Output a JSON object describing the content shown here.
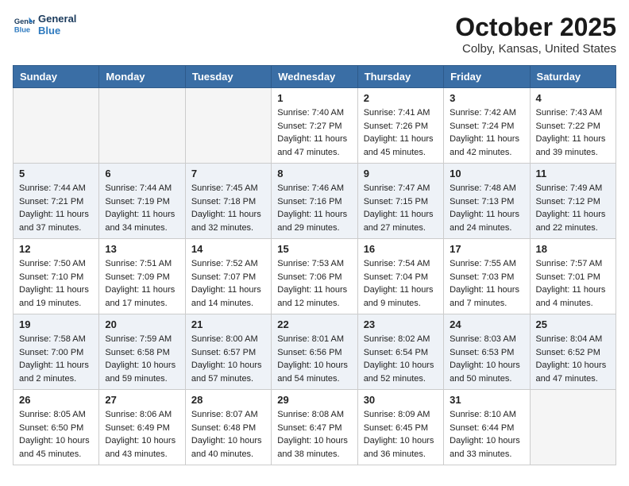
{
  "header": {
    "logo_line1": "General",
    "logo_line2": "Blue",
    "month_title": "October 2025",
    "location": "Colby, Kansas, United States"
  },
  "weekdays": [
    "Sunday",
    "Monday",
    "Tuesday",
    "Wednesday",
    "Thursday",
    "Friday",
    "Saturday"
  ],
  "weeks": [
    [
      {
        "day": "",
        "sunrise": "",
        "sunset": "",
        "daylight": "",
        "empty": true
      },
      {
        "day": "",
        "sunrise": "",
        "sunset": "",
        "daylight": "",
        "empty": true
      },
      {
        "day": "",
        "sunrise": "",
        "sunset": "",
        "daylight": "",
        "empty": true
      },
      {
        "day": "1",
        "sunrise": "Sunrise: 7:40 AM",
        "sunset": "Sunset: 7:27 PM",
        "daylight": "Daylight: 11 hours and 47 minutes."
      },
      {
        "day": "2",
        "sunrise": "Sunrise: 7:41 AM",
        "sunset": "Sunset: 7:26 PM",
        "daylight": "Daylight: 11 hours and 45 minutes."
      },
      {
        "day": "3",
        "sunrise": "Sunrise: 7:42 AM",
        "sunset": "Sunset: 7:24 PM",
        "daylight": "Daylight: 11 hours and 42 minutes."
      },
      {
        "day": "4",
        "sunrise": "Sunrise: 7:43 AM",
        "sunset": "Sunset: 7:22 PM",
        "daylight": "Daylight: 11 hours and 39 minutes."
      }
    ],
    [
      {
        "day": "5",
        "sunrise": "Sunrise: 7:44 AM",
        "sunset": "Sunset: 7:21 PM",
        "daylight": "Daylight: 11 hours and 37 minutes."
      },
      {
        "day": "6",
        "sunrise": "Sunrise: 7:44 AM",
        "sunset": "Sunset: 7:19 PM",
        "daylight": "Daylight: 11 hours and 34 minutes."
      },
      {
        "day": "7",
        "sunrise": "Sunrise: 7:45 AM",
        "sunset": "Sunset: 7:18 PM",
        "daylight": "Daylight: 11 hours and 32 minutes."
      },
      {
        "day": "8",
        "sunrise": "Sunrise: 7:46 AM",
        "sunset": "Sunset: 7:16 PM",
        "daylight": "Daylight: 11 hours and 29 minutes."
      },
      {
        "day": "9",
        "sunrise": "Sunrise: 7:47 AM",
        "sunset": "Sunset: 7:15 PM",
        "daylight": "Daylight: 11 hours and 27 minutes."
      },
      {
        "day": "10",
        "sunrise": "Sunrise: 7:48 AM",
        "sunset": "Sunset: 7:13 PM",
        "daylight": "Daylight: 11 hours and 24 minutes."
      },
      {
        "day": "11",
        "sunrise": "Sunrise: 7:49 AM",
        "sunset": "Sunset: 7:12 PM",
        "daylight": "Daylight: 11 hours and 22 minutes."
      }
    ],
    [
      {
        "day": "12",
        "sunrise": "Sunrise: 7:50 AM",
        "sunset": "Sunset: 7:10 PM",
        "daylight": "Daylight: 11 hours and 19 minutes."
      },
      {
        "day": "13",
        "sunrise": "Sunrise: 7:51 AM",
        "sunset": "Sunset: 7:09 PM",
        "daylight": "Daylight: 11 hours and 17 minutes."
      },
      {
        "day": "14",
        "sunrise": "Sunrise: 7:52 AM",
        "sunset": "Sunset: 7:07 PM",
        "daylight": "Daylight: 11 hours and 14 minutes."
      },
      {
        "day": "15",
        "sunrise": "Sunrise: 7:53 AM",
        "sunset": "Sunset: 7:06 PM",
        "daylight": "Daylight: 11 hours and 12 minutes."
      },
      {
        "day": "16",
        "sunrise": "Sunrise: 7:54 AM",
        "sunset": "Sunset: 7:04 PM",
        "daylight": "Daylight: 11 hours and 9 minutes."
      },
      {
        "day": "17",
        "sunrise": "Sunrise: 7:55 AM",
        "sunset": "Sunset: 7:03 PM",
        "daylight": "Daylight: 11 hours and 7 minutes."
      },
      {
        "day": "18",
        "sunrise": "Sunrise: 7:57 AM",
        "sunset": "Sunset: 7:01 PM",
        "daylight": "Daylight: 11 hours and 4 minutes."
      }
    ],
    [
      {
        "day": "19",
        "sunrise": "Sunrise: 7:58 AM",
        "sunset": "Sunset: 7:00 PM",
        "daylight": "Daylight: 11 hours and 2 minutes."
      },
      {
        "day": "20",
        "sunrise": "Sunrise: 7:59 AM",
        "sunset": "Sunset: 6:58 PM",
        "daylight": "Daylight: 10 hours and 59 minutes."
      },
      {
        "day": "21",
        "sunrise": "Sunrise: 8:00 AM",
        "sunset": "Sunset: 6:57 PM",
        "daylight": "Daylight: 10 hours and 57 minutes."
      },
      {
        "day": "22",
        "sunrise": "Sunrise: 8:01 AM",
        "sunset": "Sunset: 6:56 PM",
        "daylight": "Daylight: 10 hours and 54 minutes."
      },
      {
        "day": "23",
        "sunrise": "Sunrise: 8:02 AM",
        "sunset": "Sunset: 6:54 PM",
        "daylight": "Daylight: 10 hours and 52 minutes."
      },
      {
        "day": "24",
        "sunrise": "Sunrise: 8:03 AM",
        "sunset": "Sunset: 6:53 PM",
        "daylight": "Daylight: 10 hours and 50 minutes."
      },
      {
        "day": "25",
        "sunrise": "Sunrise: 8:04 AM",
        "sunset": "Sunset: 6:52 PM",
        "daylight": "Daylight: 10 hours and 47 minutes."
      }
    ],
    [
      {
        "day": "26",
        "sunrise": "Sunrise: 8:05 AM",
        "sunset": "Sunset: 6:50 PM",
        "daylight": "Daylight: 10 hours and 45 minutes."
      },
      {
        "day": "27",
        "sunrise": "Sunrise: 8:06 AM",
        "sunset": "Sunset: 6:49 PM",
        "daylight": "Daylight: 10 hours and 43 minutes."
      },
      {
        "day": "28",
        "sunrise": "Sunrise: 8:07 AM",
        "sunset": "Sunset: 6:48 PM",
        "daylight": "Daylight: 10 hours and 40 minutes."
      },
      {
        "day": "29",
        "sunrise": "Sunrise: 8:08 AM",
        "sunset": "Sunset: 6:47 PM",
        "daylight": "Daylight: 10 hours and 38 minutes."
      },
      {
        "day": "30",
        "sunrise": "Sunrise: 8:09 AM",
        "sunset": "Sunset: 6:45 PM",
        "daylight": "Daylight: 10 hours and 36 minutes."
      },
      {
        "day": "31",
        "sunrise": "Sunrise: 8:10 AM",
        "sunset": "Sunset: 6:44 PM",
        "daylight": "Daylight: 10 hours and 33 minutes."
      },
      {
        "day": "",
        "sunrise": "",
        "sunset": "",
        "daylight": "",
        "empty": true
      }
    ]
  ]
}
